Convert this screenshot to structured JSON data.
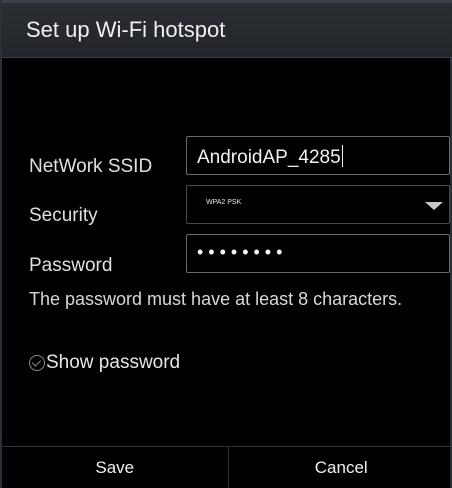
{
  "dialog": {
    "title": "Set up Wi-Fi hotspot"
  },
  "form": {
    "ssid_label": "NetWork SSID",
    "ssid_value": "AndroidAP_4285",
    "security_label": "Security",
    "security_value": "WPA2 PSK",
    "password_label": "Password",
    "password_mask": "••••••••",
    "password_hint": "The password must have at least 8 characters.",
    "show_password_label": "Show password",
    "show_password_checked": false
  },
  "footer": {
    "save_label": "Save",
    "cancel_label": "Cancel"
  },
  "icons": {
    "dropdown": "chevron-down-icon",
    "checkbox": "check-circle-icon"
  },
  "colors": {
    "background": "#000000",
    "header": "#2b2e33",
    "field_border": "#6a6a6a"
  }
}
